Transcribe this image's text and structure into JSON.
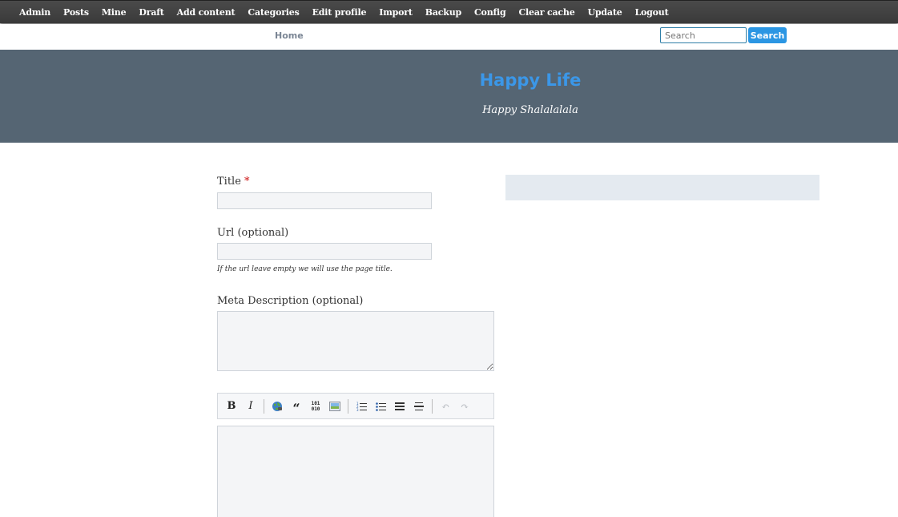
{
  "admin_bar": {
    "items": [
      {
        "label": "Admin"
      },
      {
        "label": "Posts"
      },
      {
        "label": "Mine"
      },
      {
        "label": "Draft"
      },
      {
        "label": "Add content"
      },
      {
        "label": "Categories"
      },
      {
        "label": "Edit profile"
      },
      {
        "label": "Import"
      },
      {
        "label": "Backup"
      },
      {
        "label": "Config"
      },
      {
        "label": "Clear cache"
      },
      {
        "label": "Update"
      },
      {
        "label": "Logout"
      }
    ]
  },
  "nav": {
    "home_label": "Home",
    "search_placeholder": "Search",
    "search_button_label": "Search"
  },
  "header": {
    "title": "Happy Life",
    "tagline": "Happy Shalalalala"
  },
  "form": {
    "title_label": "Title",
    "required_mark": "*",
    "title_value": "",
    "url_label": "Url (optional)",
    "url_value": "",
    "url_hint": "If the url leave empty we will use the page title.",
    "meta_label": "Meta Description (optional)",
    "meta_value": "",
    "editor": {
      "bold_glyph": "B",
      "italic_glyph": "I",
      "quote_glyph": "“",
      "code_glyph_top": "101",
      "code_glyph_bottom": "010",
      "undo_glyph": "↶",
      "redo_glyph": "↷"
    }
  },
  "colors": {
    "accent": "#2b96e3",
    "title_blue": "#3b97e8",
    "banner_bg": "#556573",
    "admin_bar_bg": "#404040",
    "required": "#cc1111",
    "sidebar_bg": "#e4eaf0"
  },
  "icons": {
    "link": "globe-link-icon",
    "quote": "quote-icon",
    "code": "code-icon",
    "image": "image-icon",
    "ordered_list": "ordered-list-icon",
    "unordered_list": "unordered-list-icon",
    "heading": "heading-icon",
    "horizontal_rule": "horizontal-rule-icon",
    "undo": "undo-icon",
    "redo": "redo-icon"
  }
}
